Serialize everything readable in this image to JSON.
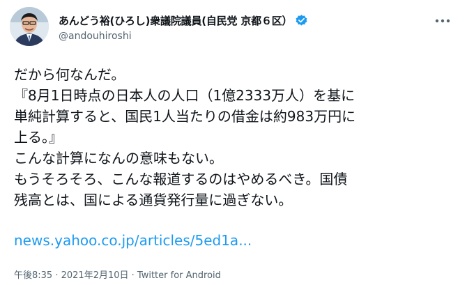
{
  "author": {
    "display_name": "あんどう裕(ひろし)衆議院議員(自民党 京都６区）",
    "username": "@andouhiroshi",
    "avatar_icon": "avatar-photo",
    "verified_icon": "verified-badge-icon",
    "verified_color": "#1d9bf0"
  },
  "more_icon": "more-dots-icon",
  "tweet": {
    "lines": [
      "だから何なんだ。",
      "『8月1日時点の日本人の人口（1億2333万人）を基に",
      "単純計算すると、国民1人当たりの借金は約983万円に",
      "上る。』",
      "こんな計算になんの意味もない。",
      "もうそろそろ、こんな報道するのはやめるべき。国債",
      "残高とは、国による通貨発行量に過ぎない。"
    ],
    "link": "news.yahoo.co.jp/articles/5ed1a..."
  },
  "meta": {
    "time": "午後8:35",
    "separator1": " · ",
    "date": "2021年2月10日",
    "separator2": " · ",
    "source": "Twitter for Android"
  },
  "colors": {
    "link": "#1d9bf0",
    "secondary_text": "#536471",
    "primary_text": "#0f1419"
  }
}
